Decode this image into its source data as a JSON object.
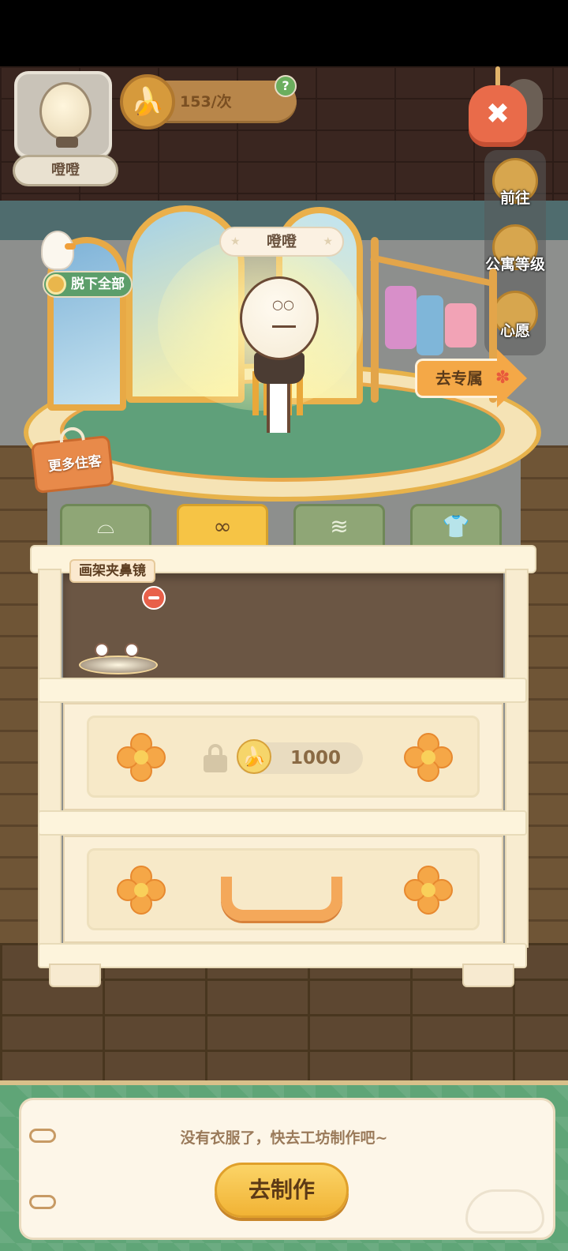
{
  "header": {
    "avatar_name": "噔噔",
    "cost": "153/次",
    "help_symbol": "?",
    "close_symbol": "✖"
  },
  "side_menu": [
    {
      "label": "前往",
      "icon": "location-pin-icon"
    },
    {
      "label": "公寓等级",
      "icon": "cat-badge-icon"
    },
    {
      "label": "心愿",
      "icon": "heart-book-icon"
    }
  ],
  "stage": {
    "character_name": "噔噔",
    "take_off_all": "脱下全部",
    "go_exclusive": "去专属",
    "more_residents": "更多住客"
  },
  "categories": [
    {
      "name": "hat",
      "icon": "hat-icon",
      "glyph": "⌓",
      "active": false
    },
    {
      "name": "glasses",
      "icon": "glasses-icon",
      "glyph": "∞",
      "active": true
    },
    {
      "name": "scarf",
      "icon": "scarf-icon",
      "glyph": "≋",
      "active": false
    },
    {
      "name": "shirt",
      "icon": "shirt-icon",
      "glyph": "👕",
      "active": false
    }
  ],
  "wardrobe": {
    "item_label": "画架夹鼻镜",
    "locked_price": "1000"
  },
  "bottom": {
    "notice": "没有衣服了，快去工坊制作吧~",
    "make_button": "去制作"
  },
  "colors": {
    "accent_orange": "#f4a847",
    "accent_green": "#5fa577",
    "active_tab": "#f6c445",
    "inactive_tab": "#8fa676"
  }
}
